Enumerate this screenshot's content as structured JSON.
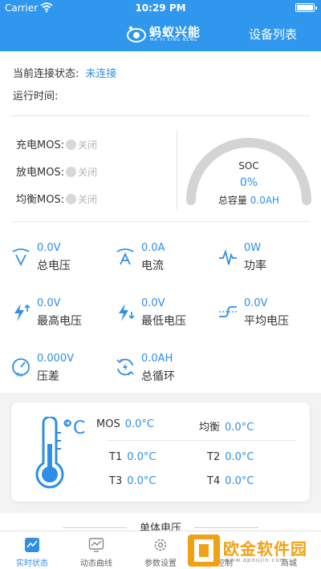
{
  "statusbar": {
    "carrier": "Carrier",
    "time": "10:29 PM"
  },
  "nav": {
    "logo_text": "蚂蚁兴能",
    "logo_sub": "MA YI XING NENG",
    "right_label": "设备列表"
  },
  "connection": {
    "label": "当前连接状态:",
    "value": "未连接"
  },
  "runtime": {
    "label": "运行时间:"
  },
  "mos": [
    {
      "label": "充电MOS:",
      "state": "关闭"
    },
    {
      "label": "放电MOS:",
      "state": "关闭"
    },
    {
      "label": "均衡MOS:",
      "state": "关闭"
    }
  ],
  "soc": {
    "label": "SOC",
    "value": "0%",
    "capacity_label": "总容量",
    "capacity_value": "0.0AH",
    "fraction": 0
  },
  "metrics": [
    {
      "value": "0.0V",
      "label": "总电压",
      "icon": "total-voltage-icon"
    },
    {
      "value": "0.0A",
      "label": "电流",
      "icon": "current-icon"
    },
    {
      "value": "0W",
      "label": "功率",
      "icon": "power-icon"
    },
    {
      "value": "0.0V",
      "label": "最高电压",
      "icon": "max-voltage-icon"
    },
    {
      "value": "0.0V",
      "label": "最低电压",
      "icon": "min-voltage-icon"
    },
    {
      "value": "0.0V",
      "label": "平均电压",
      "icon": "avg-voltage-icon"
    },
    {
      "value": "0.000V",
      "label": "压差",
      "icon": "pressure-diff-icon"
    },
    {
      "value": "0.0AH",
      "label": "总循环",
      "icon": "cycle-icon"
    }
  ],
  "temps": {
    "unit_mark": "°C",
    "mos": {
      "label": "MOS",
      "value": "0.0°C"
    },
    "balance": {
      "label": "均衡",
      "value": "0.0°C"
    },
    "t1": {
      "label": "T1",
      "value": "0.0°C"
    },
    "t2": {
      "label": "T2",
      "value": "0.0°C"
    },
    "t3": {
      "label": "T3",
      "value": "0.0°C"
    },
    "t4": {
      "label": "T4",
      "value": "0.0°C"
    }
  },
  "cell_section": {
    "title": "单体电压"
  },
  "tabs": [
    {
      "label": "实时状态",
      "active": true
    },
    {
      "label": "动态曲线",
      "active": false
    },
    {
      "label": "参数设置",
      "active": false
    },
    {
      "label": "控制",
      "active": false
    },
    {
      "label": "商城",
      "active": false
    }
  ],
  "watermark": {
    "text": "欧金软件园",
    "sub": "www.apoujin.com"
  },
  "colors": {
    "primary": "#2f97ee",
    "accent_text": "#2f8ee8",
    "muted": "#b5b5b5",
    "watermark": "#f0a116"
  }
}
